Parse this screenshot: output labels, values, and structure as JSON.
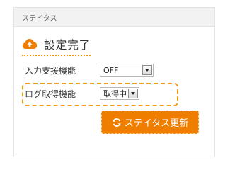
{
  "panel": {
    "header_title": "ステイタス"
  },
  "status": {
    "icon": "cloud-upload-icon",
    "text": "設定完了"
  },
  "settings": [
    {
      "label": "入力支援機能",
      "value": "OFF"
    },
    {
      "label": "ログ取得機能",
      "value": "取得中"
    }
  ],
  "actions": {
    "update_label": "ステイタス更新",
    "update_icon": "refresh-icon"
  },
  "colors": {
    "accent": "#ef7d00",
    "highlight": "#f39c12"
  }
}
